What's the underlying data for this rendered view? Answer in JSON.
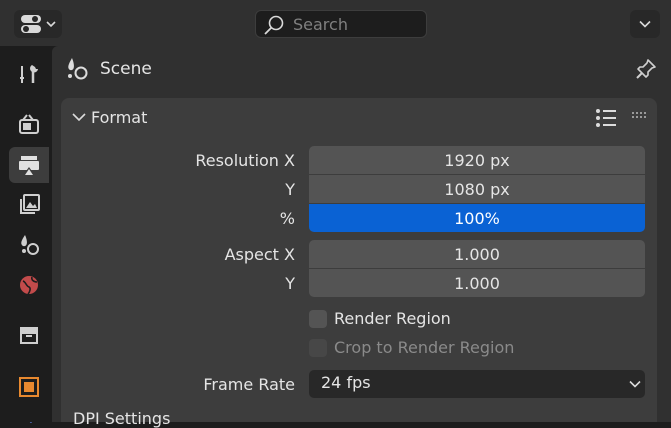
{
  "header": {
    "editor_type_icon": "properties-editor-icon",
    "search_placeholder": "Search",
    "options_icon": "chevron-down-icon"
  },
  "sidebar": {
    "tabs": [
      {
        "name": "tool",
        "icon": "tool-icon",
        "active": false
      },
      {
        "name": "render",
        "icon": "render-icon",
        "active": false
      },
      {
        "name": "output",
        "icon": "output-icon",
        "active": true
      },
      {
        "name": "view-layer",
        "icon": "view-layer-icon",
        "active": false
      },
      {
        "name": "scene",
        "icon": "scene-icon",
        "active": false
      },
      {
        "name": "world",
        "icon": "world-icon",
        "active": false
      },
      {
        "name": "collection",
        "icon": "collection-icon",
        "active": false
      },
      {
        "name": "object",
        "icon": "object-icon",
        "active": false
      }
    ]
  },
  "context": {
    "title": "Scene",
    "pin_icon": "pin-icon"
  },
  "format_panel": {
    "title": "Format",
    "resolution_x_label": "Resolution X",
    "resolution_x_value": "1920 px",
    "resolution_y_label": "Y",
    "resolution_y_value": "1080 px",
    "resolution_pct_label": "%",
    "resolution_pct_value": "100%",
    "aspect_x_label": "Aspect X",
    "aspect_x_value": "1.000",
    "aspect_y_label": "Y",
    "aspect_y_value": "1.000",
    "render_region_label": "Render Region",
    "crop_label": "Crop to Render Region",
    "frame_rate_label": "Frame Rate",
    "frame_rate_value": "24 fps"
  },
  "dpi_section": {
    "title": "DPI Settings"
  },
  "colors": {
    "accent": "#0a62d4",
    "panel_bg": "#3d3d3d",
    "field_bg": "#545454"
  }
}
